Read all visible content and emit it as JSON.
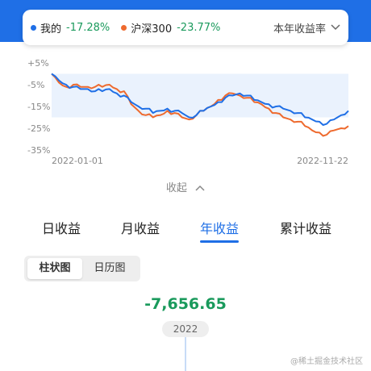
{
  "header": {
    "legend": [
      {
        "name": "我的",
        "value": "-17.28%",
        "color": "#1f6fe6"
      },
      {
        "name": "沪深300",
        "value": "-23.77%",
        "color": "#ee6a2e"
      }
    ],
    "selector_label": "本年收益率"
  },
  "chart_data": {
    "type": "line",
    "x_start": "2022-01-01",
    "x_end": "2022-11-22",
    "y_ticks": [
      "+5%",
      "-5%",
      "-15%",
      "-25%",
      "-35%"
    ],
    "ylim": [
      -35,
      5
    ],
    "series": [
      {
        "name": "我的",
        "color": "#1f6fe6",
        "values": [
          0,
          -3,
          -5,
          -6,
          -7,
          -7,
          -8,
          -8,
          -7,
          -9,
          -10,
          -13,
          -15,
          -16,
          -18,
          -17,
          -16,
          -17,
          -18,
          -20,
          -19,
          -17,
          -15,
          -13,
          -11,
          -10,
          -9,
          -10,
          -12,
          -13,
          -14,
          -15,
          -16,
          -17,
          -18,
          -20,
          -21,
          -22,
          -23,
          -21,
          -19,
          -17
        ]
      },
      {
        "name": "沪深300",
        "color": "#ee6a2e",
        "values": [
          0,
          -4,
          -6,
          -5,
          -6,
          -6,
          -6,
          -6,
          -5,
          -7,
          -8,
          -14,
          -17,
          -19,
          -20,
          -19,
          -17,
          -18,
          -20,
          -21,
          -19,
          -17,
          -15,
          -12,
          -10,
          -9,
          -10,
          -11,
          -13,
          -14,
          -16,
          -18,
          -20,
          -21,
          -22,
          -24,
          -26,
          -27,
          -28,
          -26,
          -25,
          -24
        ]
      }
    ],
    "grid": false,
    "legend_position": "top"
  },
  "collapse_label": "收起",
  "tabs": [
    {
      "label": "日收益"
    },
    {
      "label": "月收益"
    },
    {
      "label": "年收益",
      "active": true
    },
    {
      "label": "累计收益"
    }
  ],
  "segmented": {
    "options": [
      "柱状图",
      "日历图"
    ],
    "selected": "柱状图"
  },
  "summary": {
    "amount": "-7,656.65",
    "year": "2022"
  },
  "watermark": "@稀土掘金技术社区"
}
